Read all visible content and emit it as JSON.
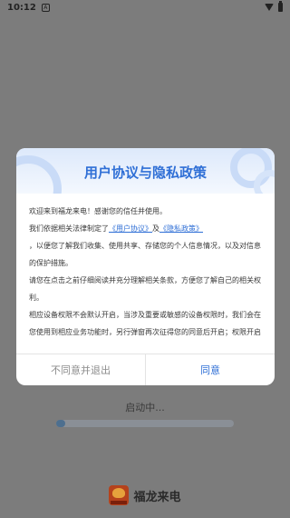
{
  "status_bar": {
    "time": "10:12",
    "app_icon_glyph": "A"
  },
  "loading": {
    "text": "启动中...",
    "progress": 0.05
  },
  "brand": {
    "name": "福龙来电"
  },
  "dialog": {
    "title": "用户协议与隐私政策",
    "lines": {
      "l1": "欢迎来到福龙来电！感谢您的信任并使用。",
      "l2_pre": "我们依据相关法律制定了",
      "user_agreement": "《用户协议》",
      "l2_mid": "及",
      "privacy_policy": "《隐私政策》",
      "l3": "，以便您了解我们收集、使用共享、存储您的个人信息情况，以及对信息",
      "l4": "的保护措施。",
      "l5": "请您在点击之前仔细阅读并充分理解相关条款，方便您了解自己的相关权",
      "l6": "利。",
      "l7": "相应设备权限不会默认开启，当涉及重要或敏感的设备权限时，我们会在",
      "l8": "您使用到相应业务功能时，另行弹窗再次征得您的同意后开启；权限开启"
    },
    "disagree_label": "不同意并退出",
    "agree_label": "同意"
  }
}
